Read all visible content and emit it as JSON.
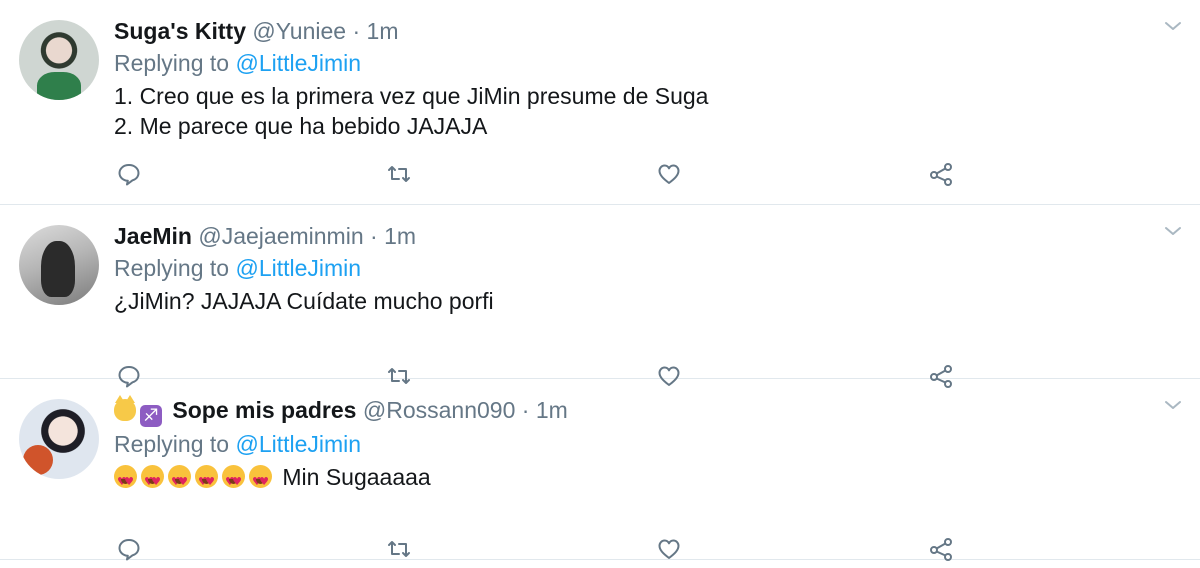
{
  "tweets": [
    {
      "name": "Suga's Kitty",
      "handle": "@Yuniee",
      "separator": "·",
      "time": "1m",
      "replying_prefix": "Replying to ",
      "replying_to": "@LittleJimin",
      "lines": [
        "1. Creo que es la primera vez que JiMin presume de Suga",
        "2. Me parece que ha bebido JAJAJA"
      ]
    },
    {
      "name": "JaeMin",
      "handle": "@Jaejaeminmin",
      "separator": "·",
      "time": "1m",
      "replying_prefix": "Replying to ",
      "replying_to": "@LittleJimin",
      "lines": [
        "¿JiMin? JAJAJA Cuídate mucho porfi"
      ]
    },
    {
      "name": "Sope mis padres",
      "name_emojis": [
        "cat-face-emoji",
        "sagittarius-emoji"
      ],
      "handle": "@Rossann090",
      "separator": "·",
      "time": "1m",
      "replying_prefix": "Replying to ",
      "replying_to": "@LittleJimin",
      "body_emoji_count": 6,
      "body_emoji": "heart-eyes-emoji",
      "lines": [
        "Min Sugaaaaa"
      ]
    }
  ],
  "icons": {
    "reply": "reply-icon",
    "retweet": "retweet-icon",
    "like": "heart-icon",
    "share": "share-icon",
    "menu": "chevron-down-icon"
  },
  "colors": {
    "link": "#1da1f2",
    "secondary": "#657786",
    "icon": "#657786",
    "divider": "#e1e8ed"
  }
}
